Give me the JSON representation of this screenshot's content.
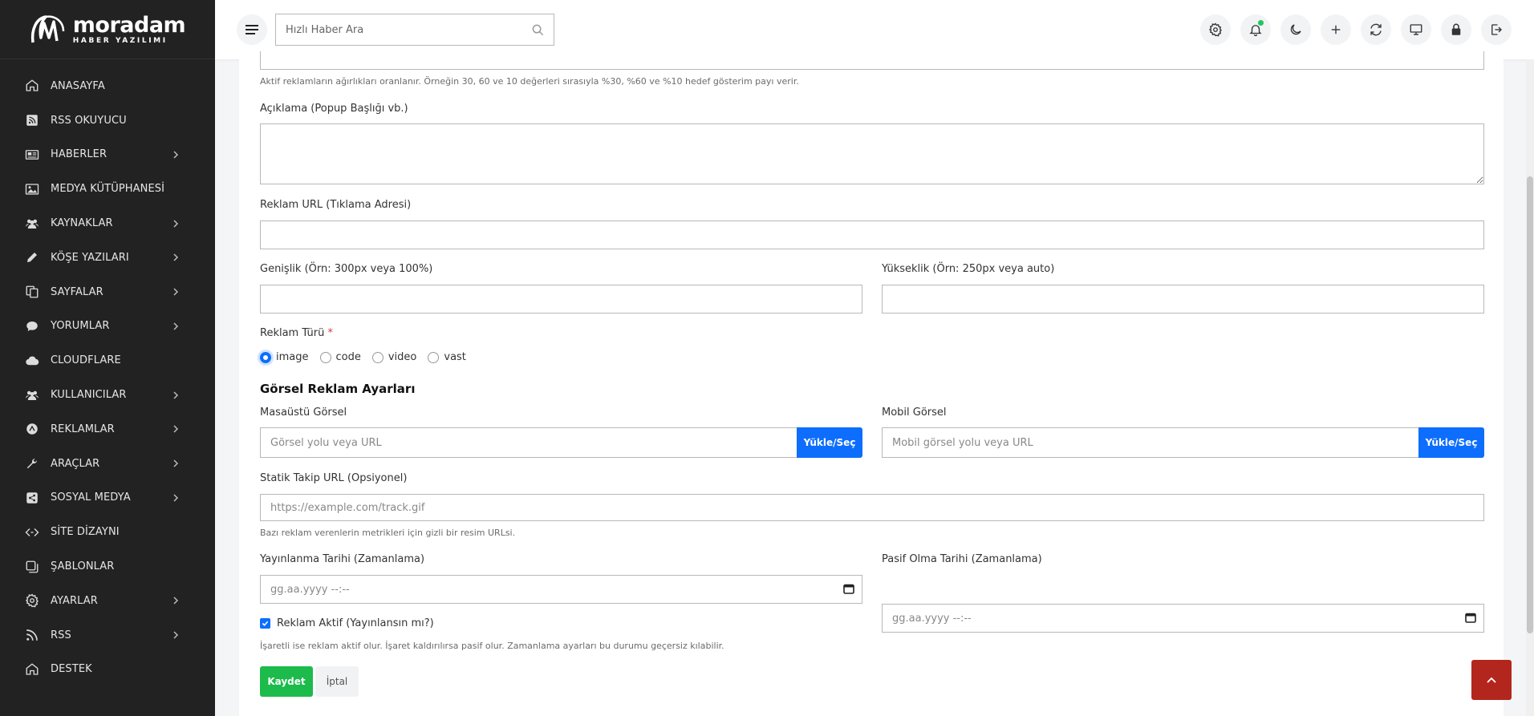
{
  "brand": {
    "name": "moradam",
    "subtitle": "HABER YAZILIMI"
  },
  "sidebar": {
    "items": [
      {
        "label": "ANASAYFA",
        "icon": "home-icon",
        "has_children": false
      },
      {
        "label": "RSS OKUYUCU",
        "icon": "rss-square-icon",
        "has_children": false
      },
      {
        "label": "HABERLER",
        "icon": "newspaper-icon",
        "has_children": true
      },
      {
        "label": "MEDYA KÜTÜPHANESİ",
        "icon": "image-icon",
        "has_children": false
      },
      {
        "label": "KAYNAKLAR",
        "icon": "users-icon",
        "has_children": true
      },
      {
        "label": "KÖŞE YAZILARI",
        "icon": "pen-icon",
        "has_children": true
      },
      {
        "label": "SAYFALAR",
        "icon": "copy-icon",
        "has_children": true
      },
      {
        "label": "YORUMLAR",
        "icon": "comment-icon",
        "has_children": true
      },
      {
        "label": "CLOUDFLARE",
        "icon": "cloud-icon",
        "has_children": false
      },
      {
        "label": "KULLANICILAR",
        "icon": "users-icon",
        "has_children": true
      },
      {
        "label": "REKLAMLAR",
        "icon": "ad-icon",
        "has_children": true
      },
      {
        "label": "ARAÇLAR",
        "icon": "wrench-icon",
        "has_children": true
      },
      {
        "label": "SOSYAL MEDYA",
        "icon": "share-icon",
        "has_children": true
      },
      {
        "label": "SİTE DİZAYNI",
        "icon": "code-icon",
        "has_children": false
      },
      {
        "label": "ŞABLONLAR",
        "icon": "template-icon",
        "has_children": false
      },
      {
        "label": "AYARLAR",
        "icon": "gear-icon",
        "has_children": true
      },
      {
        "label": "RSS",
        "icon": "rss-icon",
        "has_children": true
      },
      {
        "label": "DESTEK",
        "icon": "home-icon",
        "has_children": false
      }
    ]
  },
  "topbar": {
    "search_placeholder": "Hızlı Haber Ara",
    "actions": [
      "gear-icon",
      "bell-icon",
      "moon-icon",
      "plus-icon",
      "refresh-icon",
      "monitor-icon",
      "lock-icon",
      "logout-icon"
    ]
  },
  "form": {
    "weight_help": "Aktif reklamların ağırlıkları oranlanır. Örneğin 30, 60 ve 10 değerleri sırasıyla %30, %60 ve %10 hedef gösterim payı verir.",
    "description_label": "Açıklama (Popup Başlığı vb.)",
    "description_value": "",
    "url_label": "Reklam URL (Tıklama Adresi)",
    "url_value": "",
    "width_label": "Genişlik (Örn: 300px veya 100%)",
    "height_label": "Yükseklik (Örn: 250px veya auto)",
    "type_label": "Reklam Türü",
    "type_required_mark": "*",
    "type_options": [
      {
        "label": "image",
        "selected": true
      },
      {
        "label": "code",
        "selected": false
      },
      {
        "label": "video",
        "selected": false
      },
      {
        "label": "vast",
        "selected": false
      }
    ],
    "image_section_title": "Görsel Reklam Ayarları",
    "desktop_image_label": "Masaüstü Görsel",
    "desktop_image_placeholder": "Görsel yolu veya URL",
    "mobile_image_label": "Mobil Görsel",
    "mobile_image_placeholder": "Mobil görsel yolu veya URL",
    "upload_button": "Yükle/Seç",
    "tracking_label": "Statik Takip URL (Opsiyonel)",
    "tracking_placeholder": "https://example.com/track.gif",
    "tracking_help": "Bazı reklam verenlerin metrikleri için gizli bir resim URLsi.",
    "publish_date_label": "Yayınlanma Tarihi (Zamanlama)",
    "expire_date_label": "Pasif Olma Tarihi (Zamanlama)",
    "date_placeholder": "gg.aa.yyyy --:--",
    "active_label": "Reklam Aktif (Yayınlansın mı?)",
    "active_checked": true,
    "active_help": "İşaretli ise reklam aktif olur. İşaret kaldırılırsa pasif olur. Zamanlama ayarları bu durumu geçersiz kılabilir.",
    "save_button": "Kaydet",
    "cancel_button": "İptal"
  },
  "colors": {
    "primary": "#0d6efd",
    "success": "#1cbb4b",
    "danger": "#b3261e",
    "sidebar_bg": "#222222"
  }
}
